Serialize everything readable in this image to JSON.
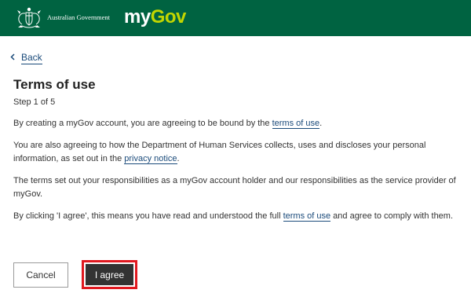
{
  "header": {
    "gov_name": "Australian Government",
    "logo_my": "my",
    "logo_gov": "Gov",
    "colors": {
      "bar": "#006341",
      "logo_accent": "#c2d600"
    }
  },
  "nav": {
    "back_label": "Back",
    "back_icon": "chevron-left-icon"
  },
  "page": {
    "title": "Terms of use",
    "step": "Step 1 of 5",
    "p1_before": "By creating a myGov account, you are agreeing to be bound by the ",
    "p1_link": "terms of use",
    "p1_after": ".",
    "p2_before": "You are also agreeing to how the Department of Human Services collects, uses and discloses your personal information, as set out in the ",
    "p2_link": "privacy notice",
    "p2_after": ".",
    "p3": "The terms set out your responsibilities as a myGov account holder and our responsibilities as the service provider of myGov.",
    "p4_before": "By clicking 'I agree', this means you have read and understood the full ",
    "p4_link": "terms of use",
    "p4_after": " and agree to comply with them."
  },
  "buttons": {
    "cancel": "Cancel",
    "agree": "I agree",
    "highlight_color": "#e0181f"
  }
}
